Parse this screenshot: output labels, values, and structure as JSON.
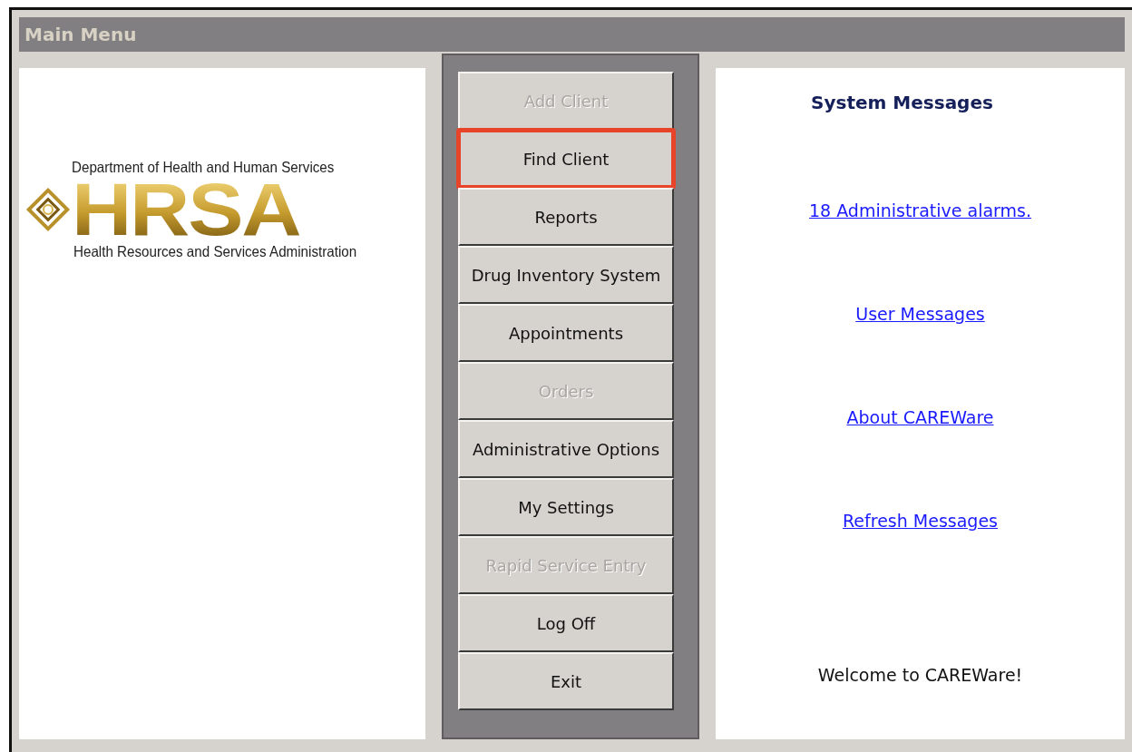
{
  "window": {
    "title": "Main Menu"
  },
  "logo": {
    "top_line": "Department of Health and Human Services",
    "wordmark": "HRSA",
    "bottom_line": "Health Resources and Services Administration"
  },
  "menu_buttons": [
    {
      "label": "Add Client",
      "disabled": true,
      "highlighted": false
    },
    {
      "label": "Find Client",
      "disabled": false,
      "highlighted": true
    },
    {
      "label": "Reports",
      "disabled": false,
      "highlighted": false
    },
    {
      "label": "Drug Inventory System",
      "disabled": false,
      "highlighted": false
    },
    {
      "label": "Appointments",
      "disabled": false,
      "highlighted": false
    },
    {
      "label": "Orders",
      "disabled": true,
      "highlighted": false
    },
    {
      "label": "Administrative Options",
      "disabled": false,
      "highlighted": false
    },
    {
      "label": "My Settings",
      "disabled": false,
      "highlighted": false
    },
    {
      "label": "Rapid Service Entry",
      "disabled": true,
      "highlighted": false
    },
    {
      "label": "Log Off",
      "disabled": false,
      "highlighted": false
    },
    {
      "label": "Exit",
      "disabled": false,
      "highlighted": false
    }
  ],
  "messages": {
    "heading": "System Messages",
    "links": [
      "18 Administrative alarms.",
      "User Messages",
      "About CAREWare",
      "Refresh Messages"
    ],
    "welcome": "Welcome to CAREWare!"
  }
}
